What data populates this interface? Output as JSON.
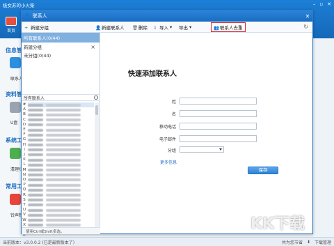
{
  "background_app": {
    "title": "极女苏的小火柴",
    "home_label": "首页",
    "sections": [
      "信息管",
      "资料管",
      "系统工",
      "常用工"
    ],
    "apps": [
      "联系人",
      "U盘",
      "清理垃",
      "铃声制"
    ]
  },
  "dialog": {
    "title": "联系人",
    "toolbar": {
      "new_group": "新建分组",
      "new_contact": "新建联系人",
      "delete": "删除",
      "import": "导入",
      "export": "导出",
      "dedupe": "联系人去重"
    }
  },
  "groups": {
    "header": "所有联系人(0/44)",
    "items": [
      "新建分组",
      "未分组(0/44)"
    ],
    "all_contacts_label": "所有联系人",
    "alphabet": [
      "#",
      "A",
      "B",
      "C",
      "D",
      "E",
      "F",
      "G",
      "H",
      "I",
      "J",
      "K",
      "L",
      "M",
      "N",
      "O",
      "P",
      "Q",
      "R",
      "S",
      "T",
      "U",
      "V",
      "W",
      "X",
      "Y",
      "Z"
    ],
    "hint": "使用Ctrl或Shift多选。"
  },
  "form": {
    "title": "快速添加联系人",
    "fields": [
      "姓",
      "名",
      "移动电话",
      "电子邮件"
    ],
    "group_label": "分组",
    "more_link": "更多信息",
    "save_label": "保存"
  },
  "statusbar": {
    "version": "当前版本：v3.0.0.2",
    "update_note": "(已是最新版本了)",
    "storage": "共为您节省",
    "download_mgr": "下载管理"
  },
  "watermark": "KK下载"
}
